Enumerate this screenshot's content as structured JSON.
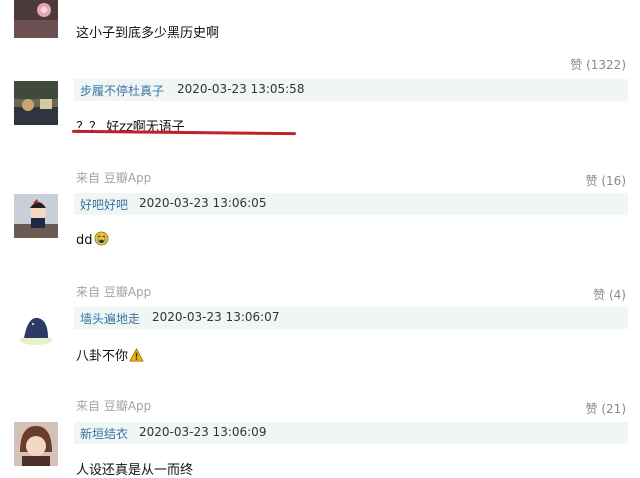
{
  "comments": [
    {
      "content": "这小子到底多少黑历史啊",
      "like": "赞 (1322)"
    },
    {
      "username": "步履不停杜真子",
      "time": "2020-03-23 13:05:58",
      "content": "？？ 好zz啊无语子",
      "source": "来自 豆瓣App",
      "like": "赞 (16)"
    },
    {
      "username": "好吧好吧",
      "time": "2020-03-23 13:06:05",
      "content": "dd",
      "content_emoji": "crying-face-emoji",
      "source": "来自 豆瓣App",
      "like": "赞 (4)"
    },
    {
      "username": "墙头遍地走",
      "time": "2020-03-23 13:06:07",
      "content": "八卦不你",
      "content_emoji": "warning-emoji",
      "source": "来自 豆瓣App",
      "like": "赞 (21)"
    },
    {
      "username": "新垣结衣",
      "time": "2020-03-23 13:06:09",
      "content": "人设还真是从一而终"
    }
  ],
  "colors": {
    "username": "#3a74a6",
    "meta_bar": "#f0f6f3",
    "highlight_underline": "#c0202c",
    "muted": "#a3a3a3"
  }
}
